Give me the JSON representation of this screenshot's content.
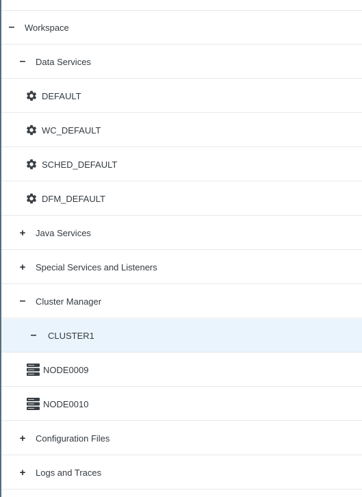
{
  "tree": {
    "workspace": {
      "toggle": "–",
      "label": "Workspace"
    },
    "data_services": {
      "toggle": "–",
      "label": "Data Services"
    },
    "default": {
      "label": "DEFAULT"
    },
    "wc_default": {
      "label": "WC_DEFAULT"
    },
    "sched_default": {
      "label": "SCHED_DEFAULT"
    },
    "dfm_default": {
      "label": "DFM_DEFAULT"
    },
    "java_services": {
      "toggle": "+",
      "label": "Java Services"
    },
    "special_services": {
      "toggle": "+",
      "label": "Special Services and Listeners"
    },
    "cluster_manager": {
      "toggle": "–",
      "label": "Cluster Manager"
    },
    "cluster1": {
      "toggle": "–",
      "label": "CLUSTER1"
    },
    "node0009": {
      "label": "NODE0009"
    },
    "node0010": {
      "label": "NODE0010"
    },
    "configuration_files": {
      "toggle": "+",
      "label": "Configuration Files"
    },
    "logs_and_traces": {
      "toggle": "+",
      "label": "Logs and Traces"
    }
  },
  "icons": {
    "service": "gear-icon",
    "node": "server-icon"
  },
  "colors": {
    "selected_row": "#eaf4fc",
    "divider": "#e6e8ea",
    "left_border": "#5a6b7a",
    "gear": "#3a3f45",
    "text": "#333a40"
  }
}
